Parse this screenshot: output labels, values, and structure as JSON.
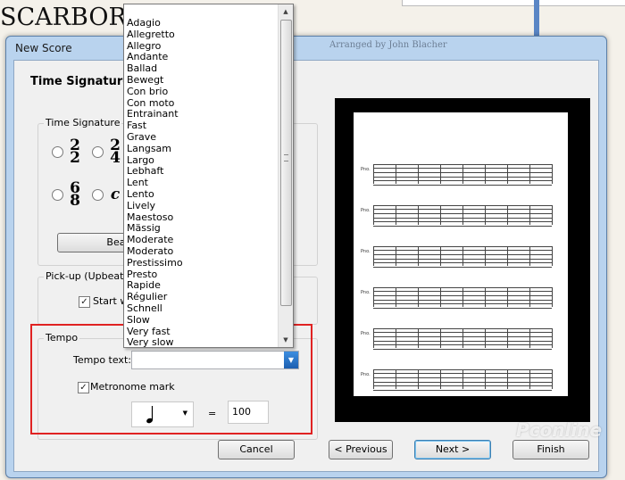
{
  "background": {
    "score_title": "SCARBOROU"
  },
  "dialog": {
    "title": "New Score",
    "ghost_title": "Arranged by John Blacher",
    "heading": "Time Signature a",
    "time_signature": {
      "group_label": "Time Signature",
      "options": [
        {
          "top": "2",
          "bottom": "2"
        },
        {
          "top": "2",
          "bottom": "4"
        },
        {
          "top": "6",
          "bottom": "8"
        },
        {
          "symbol": "c"
        }
      ],
      "beam_button": "Bear"
    },
    "pickup": {
      "group_label": "Pick-up (Upbeat) Ba",
      "checkbox_label": "Start with",
      "checked": true
    },
    "tempo": {
      "group_label": "Tempo",
      "tempo_text_label": "Tempo text:",
      "tempo_text_value": "",
      "metronome_label": "Metronome mark",
      "metronome_checked": true,
      "equals": "=",
      "bpm": "100"
    },
    "tempo_options": [
      "Adagio",
      "Allegretto",
      "Allegro",
      "Andante",
      "Ballad",
      "Bewegt",
      "Con brio",
      "Con moto",
      "Entrainant",
      "Fast",
      "Grave",
      "Langsam",
      "Largo",
      "Lebhaft",
      "Lent",
      "Lento",
      "Lively",
      "Maestoso",
      "Mässig",
      "Moderate",
      "Moderato",
      "Prestissimo",
      "Presto",
      "Rapide",
      "Régulier",
      "Schnell",
      "Slow",
      "Very fast",
      "Very slow"
    ],
    "buttons": {
      "cancel": "Cancel",
      "previous": "< Previous",
      "next": "Next >",
      "finish": "Finish"
    },
    "preview": {
      "staff_label": "Pno."
    }
  },
  "watermark": "Pconline"
}
